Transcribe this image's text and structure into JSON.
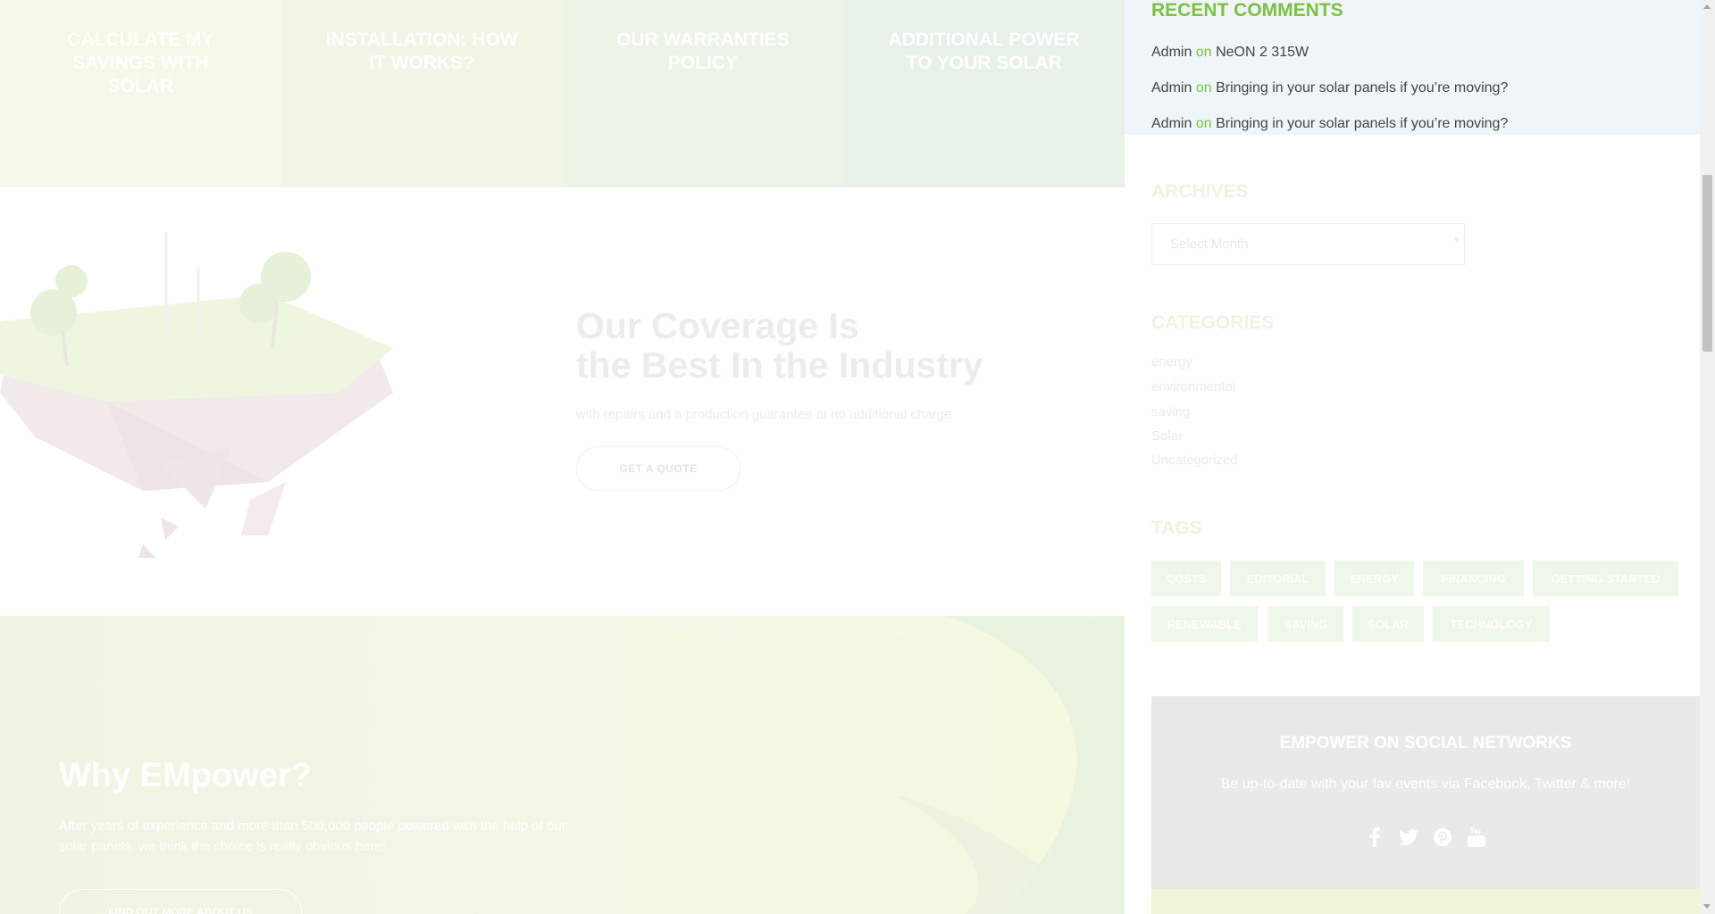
{
  "tiles": [
    {
      "label": "CALCULATE MY SAVINGS WITH SOLAR"
    },
    {
      "label": "INSTALLATION: HOW IT WORKS?"
    },
    {
      "label": "OUR WARRANTIES POLICY"
    },
    {
      "label": "ADDITIONAL POWER TO YOUR SOLAR"
    }
  ],
  "coverage": {
    "title_line1": "Our Coverage Is",
    "title_line2": "the Best In the Industry",
    "subtitle": "with repairs and a production guarantee at no additional charge",
    "button": "GET A QUOTE"
  },
  "why": {
    "title": "Why EMpower?",
    "text": "After years of experience and more than 500,000 people powered with the help of our solar panels, we think the choice is really obvious here!",
    "button": "FIND OUT MORE ABOUT US"
  },
  "sidebar": {
    "recent_comments": {
      "title": "RECENT COMMENTS",
      "items": [
        {
          "author": "Admin",
          "on": "on",
          "post": "NeON 2 315W"
        },
        {
          "author": "Admin",
          "on": "on",
          "post": "Bringing in your solar panels if you’re moving?"
        },
        {
          "author": "Admin",
          "on": "on",
          "post": "Bringing in your solar panels if you’re moving?"
        }
      ]
    },
    "archives": {
      "title": "ARCHIVES",
      "select_value": "Select Month"
    },
    "categories": {
      "title": "CATEGORIES",
      "items": [
        "energy",
        "environmental",
        "saving",
        "Solar",
        "Uncategorized"
      ]
    },
    "tags": {
      "title": "TAGS",
      "items": [
        "COSTS",
        "EDITORIAL",
        "ENERGY",
        "FINANCING",
        "GETTING STARTED",
        "RENEWABLE",
        "SAVING",
        "SOLAR",
        "TECHNOLOGY"
      ]
    },
    "social": {
      "title": "EMPOWER ON SOCIAL NETWORKS",
      "text": "Be up-to-date with your fav events via Facebook, Twitter & more!",
      "icons": [
        "facebook-icon",
        "twitter-icon",
        "pinterest-icon",
        "youtube-icon"
      ]
    }
  },
  "colors": {
    "accent": "#7dc142",
    "recent_bg": "#eff5f8",
    "social_bg": "#e9e9e9"
  }
}
